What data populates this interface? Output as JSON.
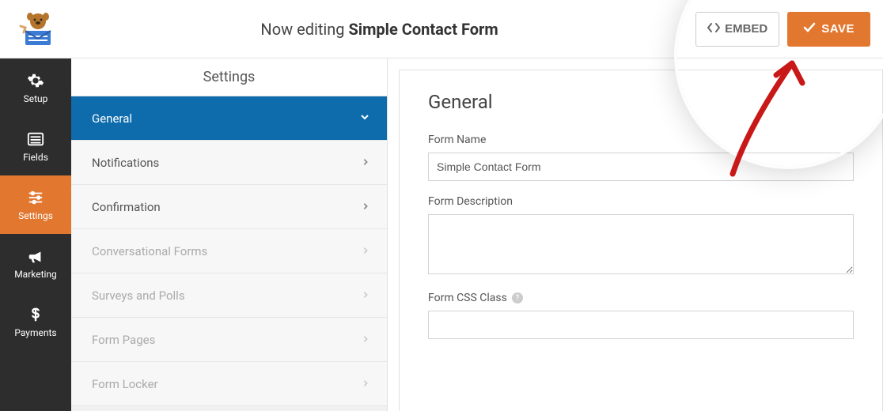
{
  "header": {
    "editing_prefix": "Now editing ",
    "form_title": "Simple Contact Form",
    "embed_label": "EMBED",
    "save_label": "SAVE"
  },
  "nav": {
    "items": [
      {
        "label": "Setup",
        "icon": "gear-icon"
      },
      {
        "label": "Fields",
        "icon": "list-icon"
      },
      {
        "label": "Settings",
        "icon": "sliders-icon"
      },
      {
        "label": "Marketing",
        "icon": "bullhorn-icon"
      },
      {
        "label": "Payments",
        "icon": "dollar-icon"
      }
    ]
  },
  "settings_panel": {
    "title": "Settings",
    "items": [
      {
        "label": "General",
        "active": true,
        "disabled": false
      },
      {
        "label": "Notifications",
        "active": false,
        "disabled": false
      },
      {
        "label": "Confirmation",
        "active": false,
        "disabled": false
      },
      {
        "label": "Conversational Forms",
        "active": false,
        "disabled": true
      },
      {
        "label": "Surveys and Polls",
        "active": false,
        "disabled": true
      },
      {
        "label": "Form Pages",
        "active": false,
        "disabled": true
      },
      {
        "label": "Form Locker",
        "active": false,
        "disabled": true
      }
    ]
  },
  "form": {
    "heading": "General",
    "name_label": "Form Name",
    "name_value": "Simple Contact Form",
    "description_label": "Form Description",
    "description_value": "",
    "css_class_label": "Form CSS Class",
    "css_class_value": ""
  }
}
